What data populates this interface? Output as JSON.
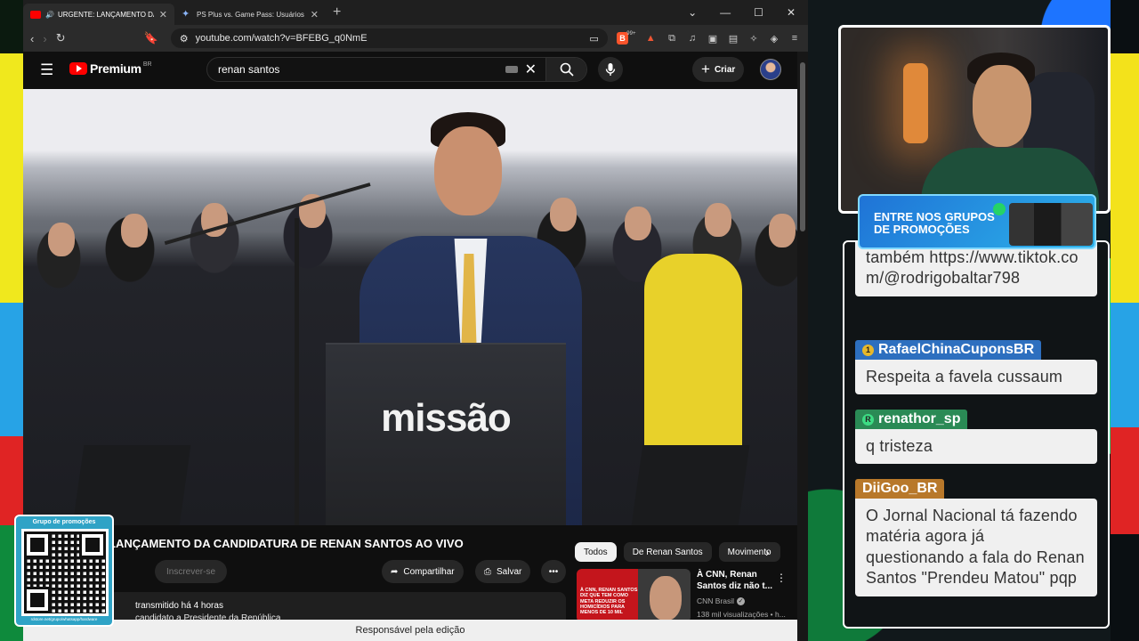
{
  "colors": {
    "yt_red": "#ff0000",
    "chat_user_blue": "#2d6fbf",
    "chat_user_green": "#2a8a55",
    "chat_user_orange": "#b8782a"
  },
  "browser": {
    "tabs": [
      {
        "title": "URGENTE: LANÇAMENTO DA CANDIDATURA",
        "active": true,
        "icon": "youtube-icon"
      },
      {
        "title": "PS Plus vs. Game Pass: Usuários Ativos - Google",
        "active": false,
        "icon": "gemini-icon"
      }
    ],
    "new_tab": "+",
    "url": "youtube.com/watch?v=BFEBG_q0NmE",
    "shield_badge": "99+"
  },
  "youtube": {
    "logo_word": "Premium",
    "logo_region": "BR",
    "search_value": "renan santos",
    "create_label": "Criar",
    "video_title": "LANÇAMENTO DA CANDIDATURA DE RENAN SANTOS AO VIVO",
    "podium_logo": "missão",
    "subscribe_label": "Inscrever-se",
    "share_label": "Compartilhar",
    "save_label": "Salvar",
    "description_meta": "transmitido há 4 horas",
    "description_line": "candidato a Presidente da República",
    "chips": [
      "Todos",
      "De Renan Santos",
      "Movimento"
    ],
    "recommendation": {
      "thumb_text": "À CNN, RENAN SANTOS DIZ QUE TEM COMO META REDUZIR OS HOMICÍDIOS PARA MENOS DE 10 MIL",
      "title": "À CNN, Renan Santos diz não t...",
      "channel": "CNN Brasil",
      "views": "138 mil visualizações • h..."
    },
    "status_tooltip": "Responsável pela edição"
  },
  "overlay": {
    "qr_label": "Grupo de promoções",
    "qr_url": "rdstore.net/grupo/whatsapp/hardware",
    "promo_text": "ENTRE NOS GRUPOS\nDE PROMOÇÕES",
    "chat": [
      {
        "user": "",
        "text": "também https://www.tiktok.com/@rodrigobaltar798"
      },
      {
        "user": "RafaelChinaCuponsBR",
        "text": "Respeita a favela cussaum",
        "badge": "1"
      },
      {
        "user": "renathor_sp",
        "text": "q tristeza",
        "badge": "R"
      },
      {
        "user": "DiiGoo_BR",
        "text": "O Jornal Nacional tá fazendo matéria agora já questionando a fala do Renan Santos \"Prendeu Matou\" pqp"
      }
    ]
  }
}
